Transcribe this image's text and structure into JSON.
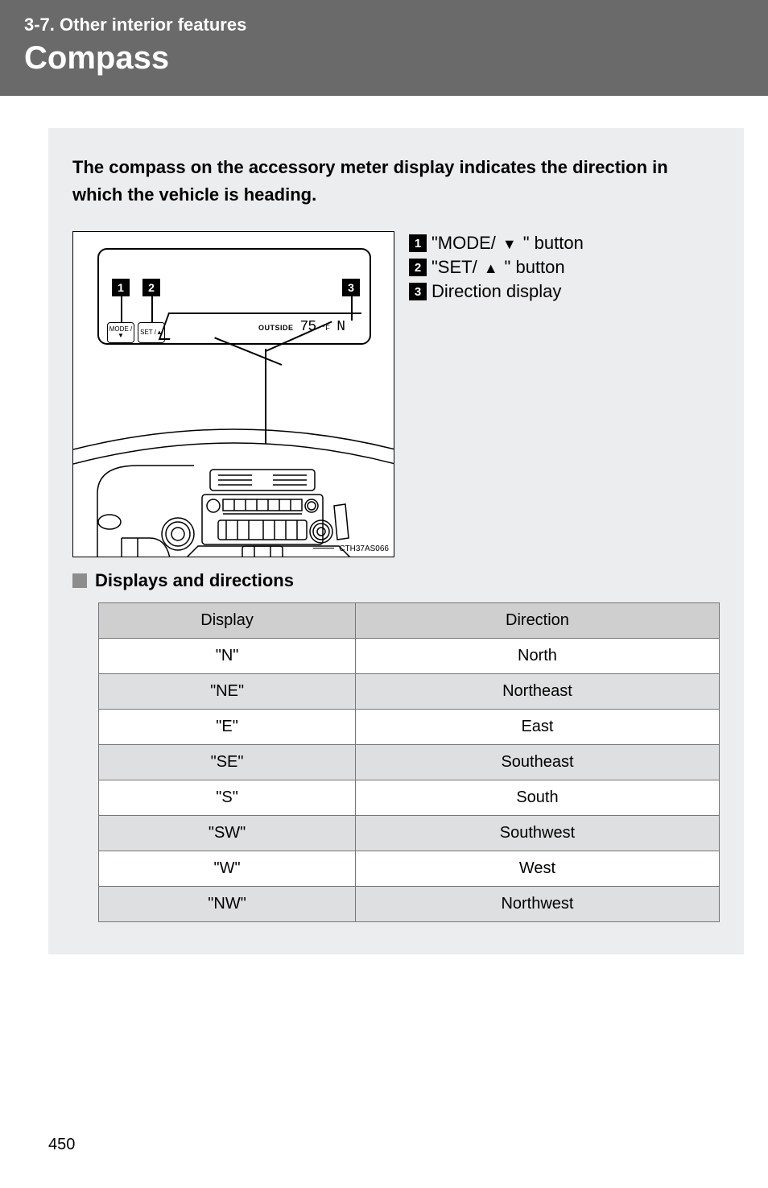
{
  "header": {
    "section_label": "3-7. Other interior features",
    "title": "Compass"
  },
  "intro": "The compass on the accessory meter display indicates the direction in which the vehicle is heading.",
  "figure": {
    "callouts": [
      {
        "num": "1",
        "prefix": "\"MODE/",
        "suffix": "\" button",
        "arrow": "down"
      },
      {
        "num": "2",
        "prefix": "\"SET/",
        "suffix": "\" button",
        "arrow": "up"
      },
      {
        "num": "3",
        "prefix": "Direction display",
        "suffix": "",
        "arrow": ""
      }
    ],
    "meter": {
      "outside_label": "OUTSIDE",
      "temp": "75",
      "unit": "°F",
      "direction": "N",
      "btn1": "MODE\n/▼",
      "btn2": "SET\n/▲"
    },
    "code": "CTH37AS066"
  },
  "subheading": "Displays and directions",
  "table": {
    "headers": [
      "Display",
      "Direction"
    ],
    "rows": [
      {
        "display": "\"N\"",
        "direction": "North"
      },
      {
        "display": "\"NE\"",
        "direction": "Northeast"
      },
      {
        "display": "\"E\"",
        "direction": "East"
      },
      {
        "display": "\"SE\"",
        "direction": "Southeast"
      },
      {
        "display": "\"S\"",
        "direction": "South"
      },
      {
        "display": "\"SW\"",
        "direction": "Southwest"
      },
      {
        "display": "\"W\"",
        "direction": "West"
      },
      {
        "display": "\"NW\"",
        "direction": "Northwest"
      }
    ]
  },
  "page_number": "450"
}
